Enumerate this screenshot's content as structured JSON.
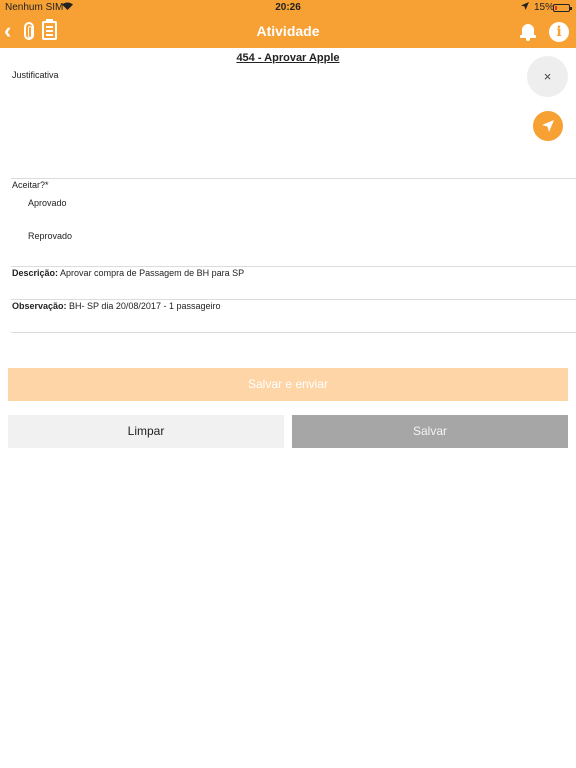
{
  "status_bar": {
    "carrier": "Nenhum SIM",
    "time": "20:26",
    "battery": "15%",
    "battery_level": 0.15,
    "wifi_icon": "wifi-icon",
    "location_icon": "location-arrow-icon"
  },
  "header": {
    "title": "Atividade",
    "back_icon": "chevron-left-icon",
    "attachment_icon": "paperclip-icon",
    "clipboard_icon": "clipboard-icon",
    "bell_icon": "bell-icon",
    "info_icon": "info-icon",
    "info_glyph": "i"
  },
  "colors": {
    "accent": "#f7a034",
    "send_button_disabled": "#fdd5a7",
    "save_button_disabled": "#a6a6a6"
  },
  "form": {
    "heading": "454 - Aprovar Apple",
    "justification_label": "Justificativa",
    "accept_label": "Aceitar?*",
    "options": [
      "Aprovado",
      "Reprovado"
    ],
    "description_label": "Descrição:",
    "description_value": "Aprovar compra de Passagem de BH para SP",
    "observation_label": "Observação:",
    "observation_value": "BH- SP dia 20/08/2017 - 1 passageiro"
  },
  "floating": {
    "close_icon": "close-icon",
    "close_glyph": "×",
    "navigate_icon": "navigation-arrow-icon"
  },
  "actions": {
    "send_label": "Salvar e enviar",
    "clear_label": "Limpar",
    "save_label": "Salvar"
  }
}
